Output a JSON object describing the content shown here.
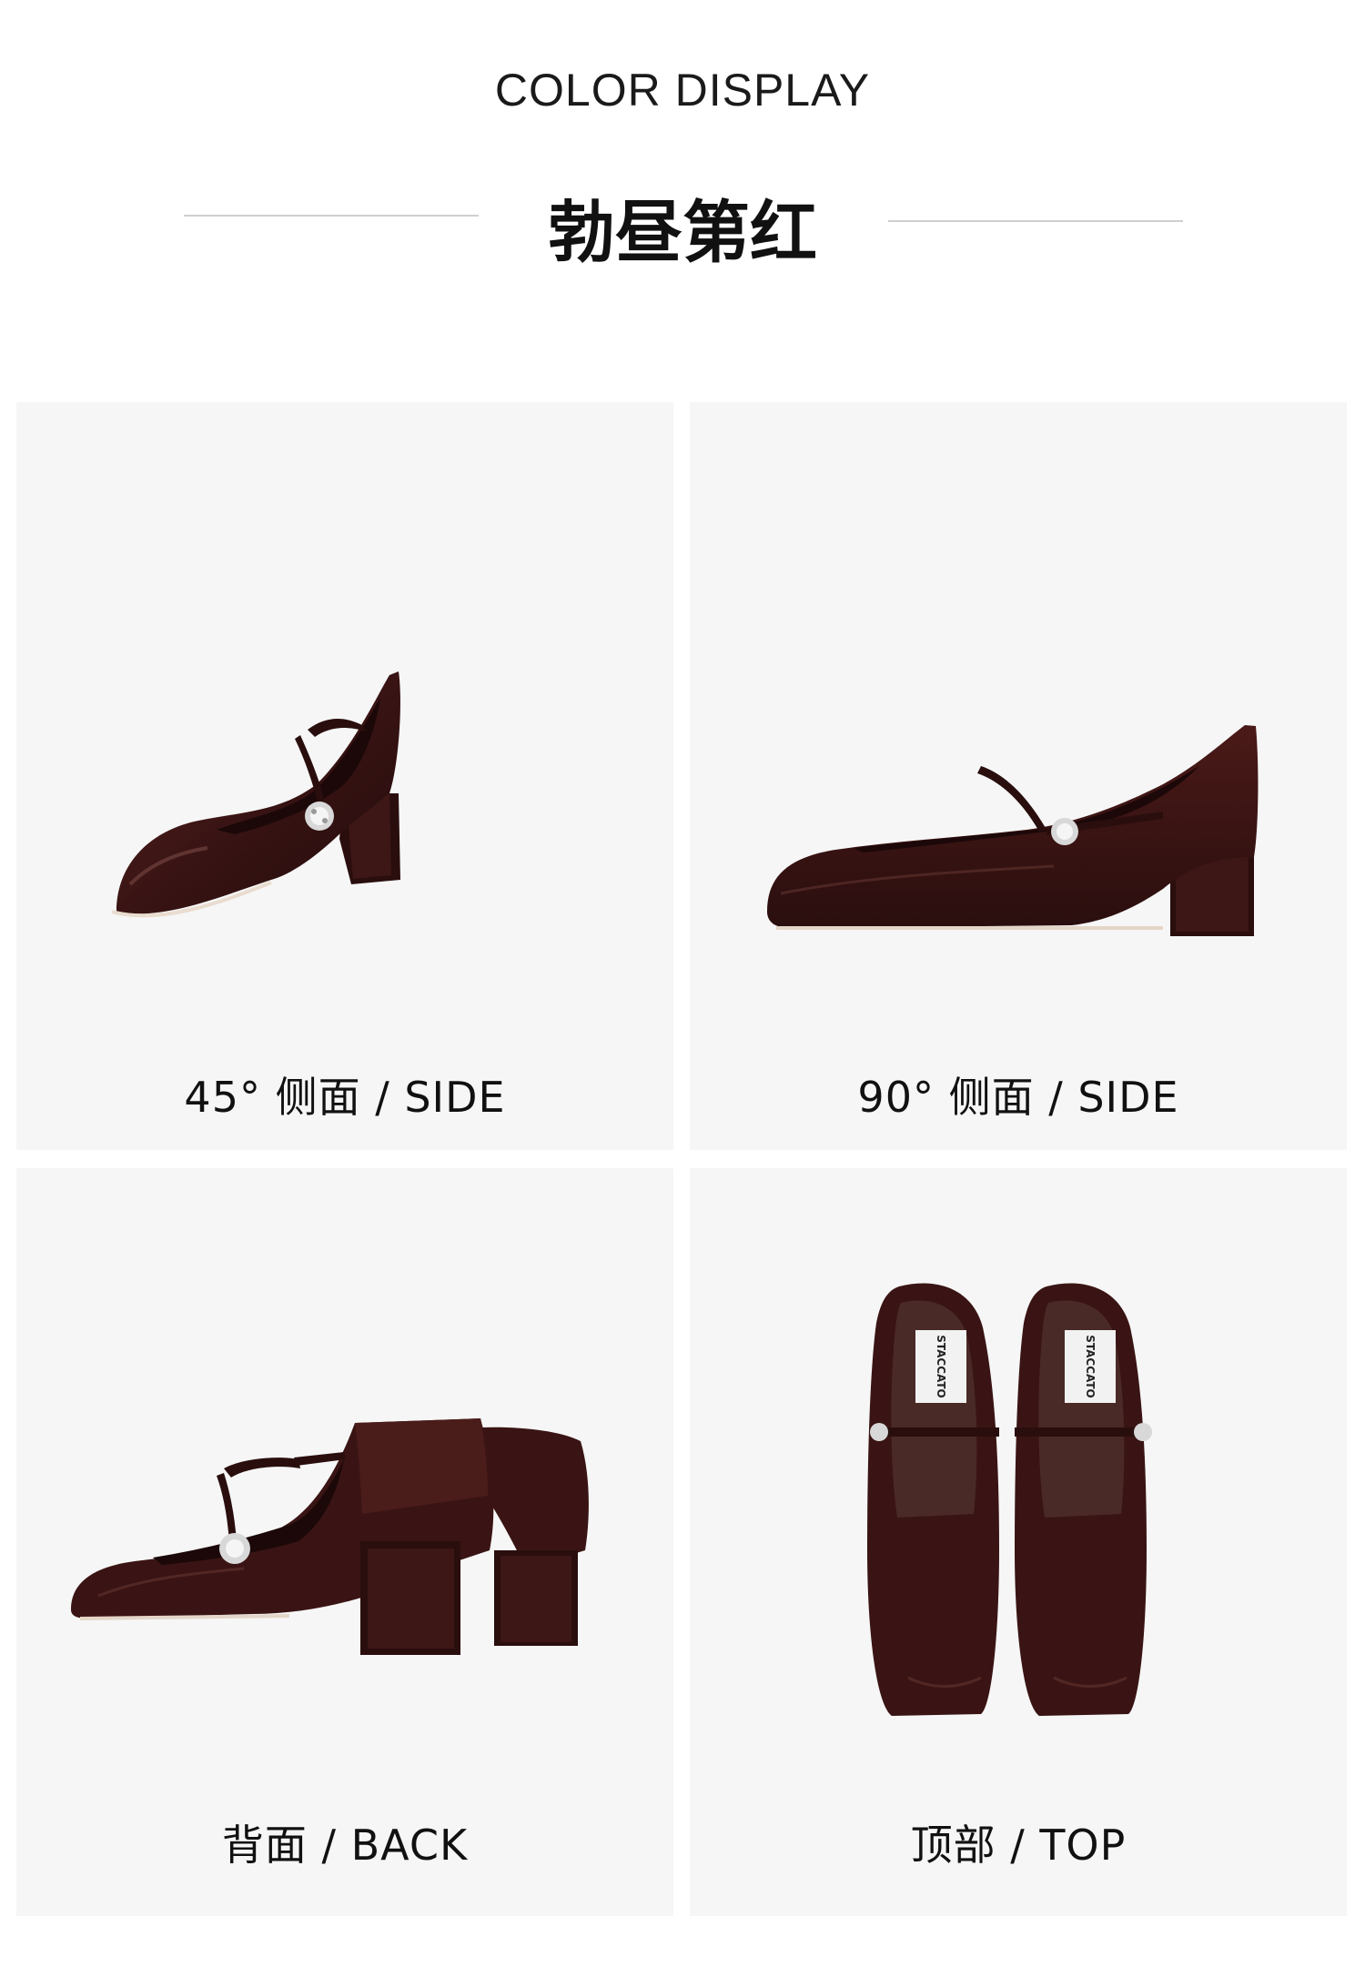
{
  "header": {
    "eyebrow": "COLOR DISPLAY",
    "color_name": "勃昼第红"
  },
  "panels": [
    {
      "caption": "45° 侧面  /  SIDE",
      "view": "side-45"
    },
    {
      "caption": "90° 侧面  /  SIDE",
      "view": "side-90"
    },
    {
      "caption": "背面  /  BACK",
      "view": "back"
    },
    {
      "caption": "顶部  /  TOP",
      "view": "top",
      "insole_brand": "STACCATO"
    }
  ],
  "colors": {
    "panel_bg": "#f6f6f6",
    "leather": "#3a1414",
    "leather_dark": "#220a0a",
    "leather_highlight": "#6a3a34",
    "rule": "#cfcfcf"
  }
}
